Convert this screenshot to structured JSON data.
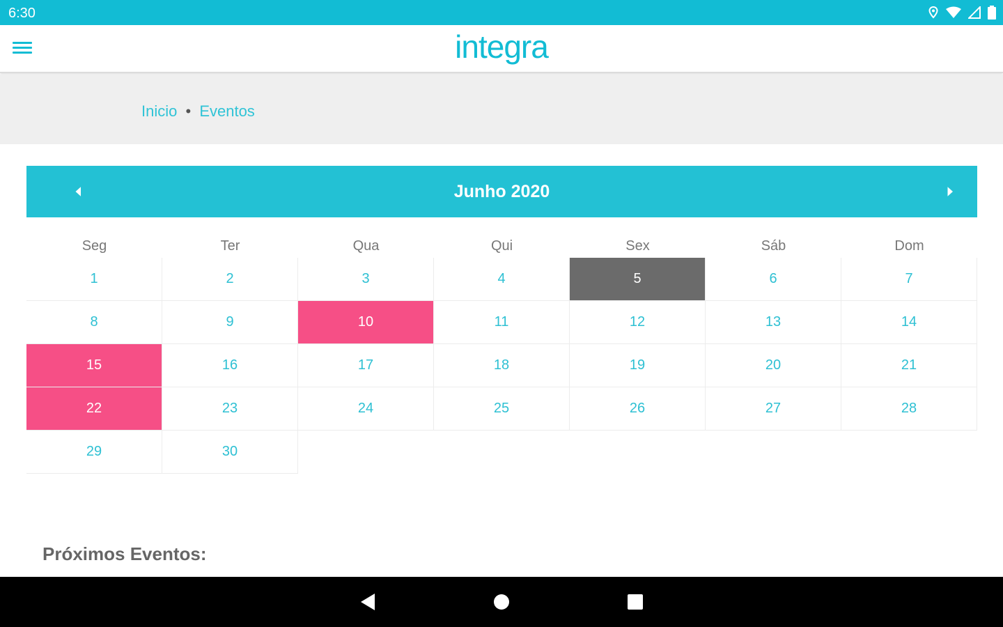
{
  "status_bar": {
    "time": "6:30",
    "icons": [
      "location-icon",
      "wifi-icon",
      "signal-icon",
      "battery-icon"
    ]
  },
  "app_bar": {
    "menu_icon": "hamburger-menu-icon",
    "logo_text": "integra"
  },
  "breadcrumb": {
    "home": "Inicio",
    "separator": "•",
    "current": "Eventos"
  },
  "calendar": {
    "month_label": "Junho 2020",
    "prev_icon": "chevron-left-icon",
    "next_icon": "chevron-right-icon",
    "weekdays": [
      "Seg",
      "Ter",
      "Qua",
      "Qui",
      "Sex",
      "Sáb",
      "Dom"
    ],
    "days": [
      {
        "label": "1",
        "state": "normal"
      },
      {
        "label": "2",
        "state": "normal"
      },
      {
        "label": "3",
        "state": "normal"
      },
      {
        "label": "4",
        "state": "normal"
      },
      {
        "label": "5",
        "state": "today"
      },
      {
        "label": "6",
        "state": "normal"
      },
      {
        "label": "7",
        "state": "normal"
      },
      {
        "label": "8",
        "state": "normal"
      },
      {
        "label": "9",
        "state": "normal"
      },
      {
        "label": "10",
        "state": "event"
      },
      {
        "label": "11",
        "state": "normal"
      },
      {
        "label": "12",
        "state": "normal"
      },
      {
        "label": "13",
        "state": "normal"
      },
      {
        "label": "14",
        "state": "normal"
      },
      {
        "label": "15",
        "state": "event"
      },
      {
        "label": "16",
        "state": "normal"
      },
      {
        "label": "17",
        "state": "normal"
      },
      {
        "label": "18",
        "state": "normal"
      },
      {
        "label": "19",
        "state": "normal"
      },
      {
        "label": "20",
        "state": "normal"
      },
      {
        "label": "21",
        "state": "normal"
      },
      {
        "label": "22",
        "state": "event"
      },
      {
        "label": "23",
        "state": "normal"
      },
      {
        "label": "24",
        "state": "normal"
      },
      {
        "label": "25",
        "state": "normal"
      },
      {
        "label": "26",
        "state": "normal"
      },
      {
        "label": "27",
        "state": "normal"
      },
      {
        "label": "28",
        "state": "normal"
      },
      {
        "label": "29",
        "state": "normal"
      },
      {
        "label": "30",
        "state": "normal"
      }
    ]
  },
  "upcoming": {
    "title": "Próximos Eventos:"
  },
  "nav_bar": {
    "buttons": [
      "back-icon",
      "home-icon",
      "recents-icon"
    ]
  },
  "colors": {
    "accent": "#12bcd4",
    "header": "#23c1d4",
    "event": "#f64f86",
    "today": "#6b6b6b"
  }
}
